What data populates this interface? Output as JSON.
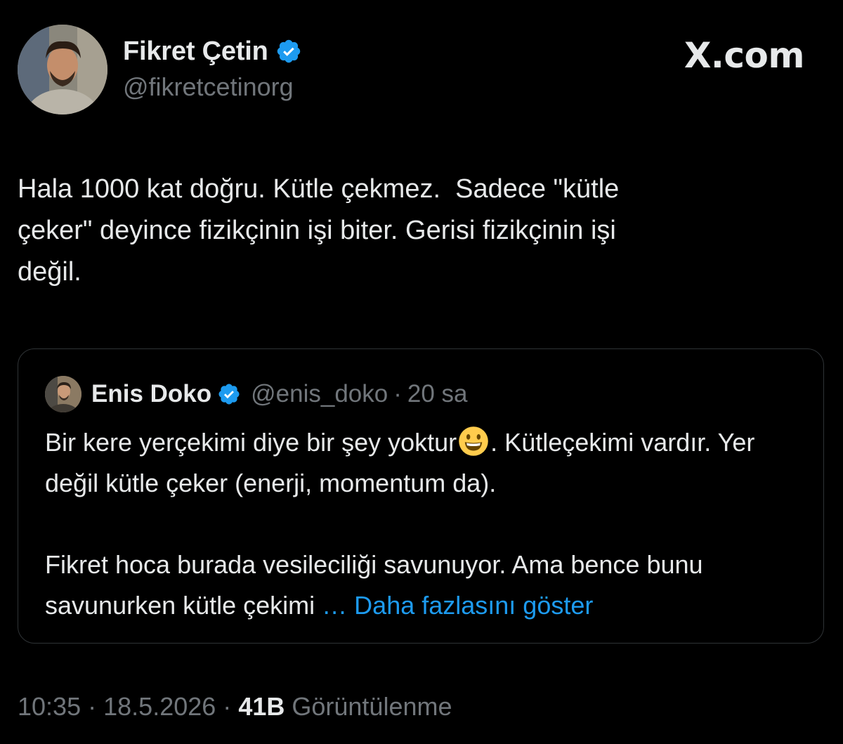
{
  "author": {
    "name": "Fikret Çetin",
    "handle": "@fikretcetinorg",
    "avatar": "profile-photo",
    "verified_icon": "verified-badge-icon"
  },
  "brand": {
    "label": "X.com"
  },
  "tweet": {
    "text": "Hala 1000 kat doğru. Kütle çekmez.  Sadece \"kütle\nçeker\" deyince fizikçinin işi biter. Gerisi fizikçinin işi\ndeğil."
  },
  "quote": {
    "name": "Enis Doko",
    "handle": "@enis_doko",
    "separator": "·",
    "time": "20 sa",
    "paragraph1_before_emoji": "Bir kere yerçekimi diye bir şey yoktur",
    "emoji": "grinning-face-emoji",
    "paragraph1_after_emoji": ". Kütleçekimi vardır. Yer değil kütle çeker (enerji, momentum da).",
    "paragraph2": "Fikret hoca burada vesileciliği savunuyor. Ama bence bunu savunurken kütle çekimi ",
    "show_more": "… Daha fazlasını göster"
  },
  "meta": {
    "time": "10:35",
    "sep1": "·",
    "date": "18.5.2026",
    "sep2": "·",
    "views_count": "41B",
    "views_label": "Görüntülenme"
  },
  "colors": {
    "background": "#000000",
    "text": "#e7e9ea",
    "secondary": "#71767b",
    "link": "#1d9bf0",
    "verified": "#1d9bf0",
    "border": "#2f3336"
  }
}
